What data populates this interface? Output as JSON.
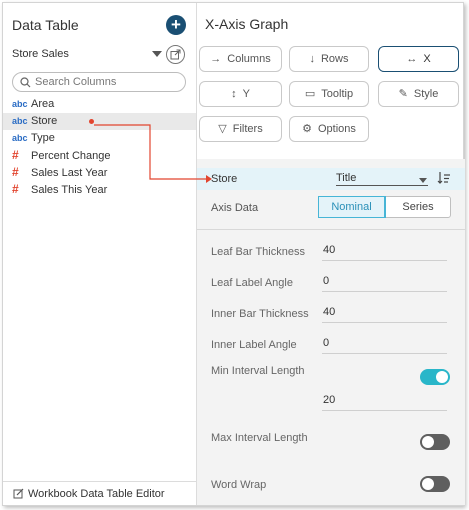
{
  "left_panel": {
    "title": "Data Table",
    "add_symbol": "+",
    "data_source": "Store Sales",
    "search_placeholder": "Search Columns",
    "columns": [
      {
        "type_label": "abc",
        "type": "text",
        "name": "Area",
        "selected": false
      },
      {
        "type_label": "abc",
        "type": "text",
        "name": "Store",
        "selected": true
      },
      {
        "type_label": "abc",
        "type": "text",
        "name": "Type",
        "selected": false
      },
      {
        "type_label": "#",
        "type": "numeric",
        "name": "Percent Change",
        "selected": false
      },
      {
        "type_label": "#",
        "type": "numeric",
        "name": "Sales Last Year",
        "selected": false
      },
      {
        "type_label": "#",
        "type": "numeric",
        "name": "Sales This Year",
        "selected": false
      }
    ],
    "footer_label": "Workbook Data Table Editor"
  },
  "right_panel": {
    "title": "X-Axis Graph",
    "chips": {
      "columns": "Columns",
      "rows": "Rows",
      "x": "X",
      "y": "Y",
      "tooltip": "Tooltip",
      "style": "Style",
      "filters": "Filters",
      "options": "Options"
    },
    "active_chip": "x",
    "assigned_column": "Store",
    "label_mode": "Title",
    "axis_data": {
      "label": "Axis Data",
      "options": [
        "Nominal",
        "Series"
      ],
      "selected": "Nominal"
    },
    "properties": {
      "leaf_bar_thickness": {
        "label": "Leaf Bar Thickness",
        "value": "40"
      },
      "leaf_label_angle": {
        "label": "Leaf Label Angle",
        "value": "0"
      },
      "inner_bar_thickness": {
        "label": "Inner Bar Thickness",
        "value": "40"
      },
      "inner_label_angle": {
        "label": "Inner Label Angle",
        "value": "0"
      },
      "min_interval_length": {
        "label": "Min Interval Length",
        "value": "20",
        "enabled": true
      },
      "max_interval_length": {
        "label": "Max Interval Length",
        "enabled": false
      },
      "word_wrap": {
        "label": "Word Wrap",
        "enabled": false
      }
    }
  },
  "colors": {
    "accent": "#1a4f73",
    "toggle_on": "#29b6c9",
    "toggle_off": "#5f5f5f",
    "highlight_row": "#e4f3f9",
    "numeric_icon": "#e2452f",
    "text_icon": "#2a6cc4",
    "drag_arrow": "#e2452f"
  }
}
